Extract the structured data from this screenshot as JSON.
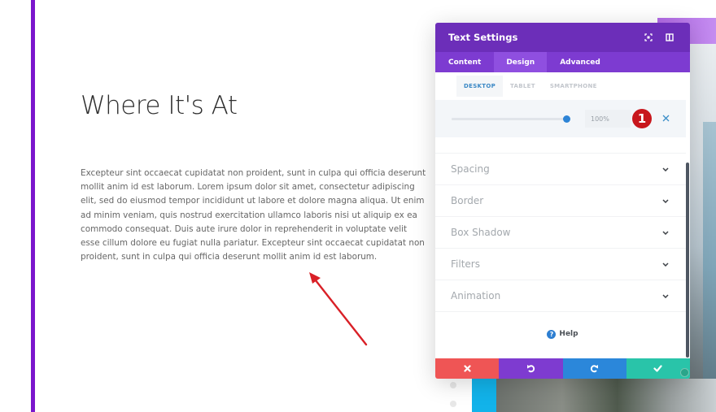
{
  "page": {
    "title": "Where It's At",
    "body": "Excepteur sint occaecat cupidatat non proident, sunt in culpa qui officia deserunt mollit anim id est laborum. Lorem ipsum dolor sit amet, consectetur adipiscing elit, sed do eiusmod tempor incididunt ut labore et dolore magna aliqua. Ut enim ad minim veniam, quis nostrud exercitation ullamco laboris nisi ut aliquip ex ea commodo consequat. Duis aute irure dolor in reprehenderit in voluptate velit esse cillum dolore eu fugiat nulla pariatur. Excepteur sint occaecat cupidatat non proident, sunt in culpa qui officia deserunt mollit anim id est laborum."
  },
  "panel": {
    "title": "Text Settings",
    "header_icons": [
      "focus-icon",
      "sidebar-toggle-icon"
    ],
    "tabs": [
      {
        "label": "Content",
        "active": false
      },
      {
        "label": "Design",
        "active": true
      },
      {
        "label": "Advanced",
        "active": false
      }
    ],
    "device_tabs": [
      {
        "label": "DESKTOP",
        "active": true
      },
      {
        "label": "TABLET",
        "active": false
      },
      {
        "label": "SMARTPHONE",
        "active": false
      }
    ],
    "slider": {
      "value_percent": 100,
      "value_text": "100%"
    },
    "step_badge": "1",
    "sections": [
      {
        "label": "Spacing"
      },
      {
        "label": "Border"
      },
      {
        "label": "Box Shadow"
      },
      {
        "label": "Filters"
      },
      {
        "label": "Animation"
      }
    ],
    "help_label": "Help",
    "footer_buttons": [
      {
        "name": "discard",
        "icon": "close-icon",
        "color": "#ef5555"
      },
      {
        "name": "undo",
        "icon": "undo-icon",
        "color": "#7e3bd0"
      },
      {
        "name": "redo",
        "icon": "redo-icon",
        "color": "#2b87da"
      },
      {
        "name": "save",
        "icon": "check-icon",
        "color": "#29c4a9"
      }
    ]
  },
  "colors": {
    "accent_bar": "#7b16cc",
    "panel_header": "#6c2eb9",
    "panel_tabs": "#7d3bd1",
    "active_tab": "#8f4fe0",
    "slider_thumb": "#2d84d6",
    "badge": "#c8171d",
    "arrow": "#d92027"
  }
}
